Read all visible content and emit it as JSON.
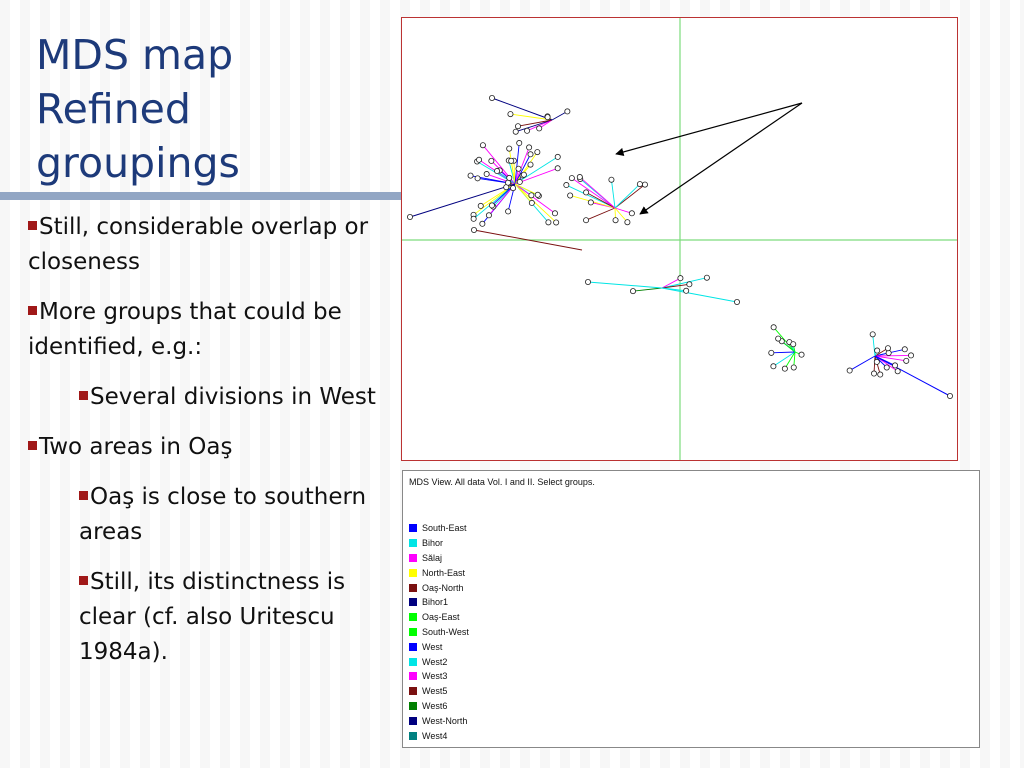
{
  "slide": {
    "title_lines": [
      "MDS map",
      "Refined",
      "groupings"
    ],
    "bullets": [
      {
        "text": "Still, considerable overlap or closeness"
      },
      {
        "text": "More groups that could be identified, e.g.:"
      },
      {
        "text": "Several divisions in West"
      },
      {
        "text": "Two areas in Oaş"
      },
      {
        "text": "Oaş is close to southern areas"
      },
      {
        "text": "Still, its distinctness is clear (cf. also Uritescu 1984a)."
      }
    ]
  },
  "legend": {
    "caption": "MDS View. All data Vol. I and II. Select groups.",
    "items": [
      {
        "label": "South-East",
        "color": "#0000ff"
      },
      {
        "label": "Bihor",
        "color": "#00e5e5"
      },
      {
        "label": "Sălaj",
        "color": "#ff00ff"
      },
      {
        "label": "North-East",
        "color": "#ffff00"
      },
      {
        "label": "Oaş-North",
        "color": "#7a1010"
      },
      {
        "label": "Bihor1",
        "color": "#00007f"
      },
      {
        "label": "Oaş-East",
        "color": "#00ff00"
      },
      {
        "label": "South-West",
        "color": "#00ff00"
      },
      {
        "label": "West",
        "color": "#0000ff"
      },
      {
        "label": "West2",
        "color": "#00e5e5"
      },
      {
        "label": "West3",
        "color": "#ff00ff"
      },
      {
        "label": "West5",
        "color": "#7a1010"
      },
      {
        "label": "West6",
        "color": "#007f00"
      },
      {
        "label": "West-North",
        "color": "#00007f"
      },
      {
        "label": "West4",
        "color": "#008080"
      }
    ]
  },
  "colors": {
    "title": "#1d3a7a",
    "bullet_marker": "#a01818",
    "axis_lines": "#7ddc7d",
    "plot_border": "#b33333"
  }
}
